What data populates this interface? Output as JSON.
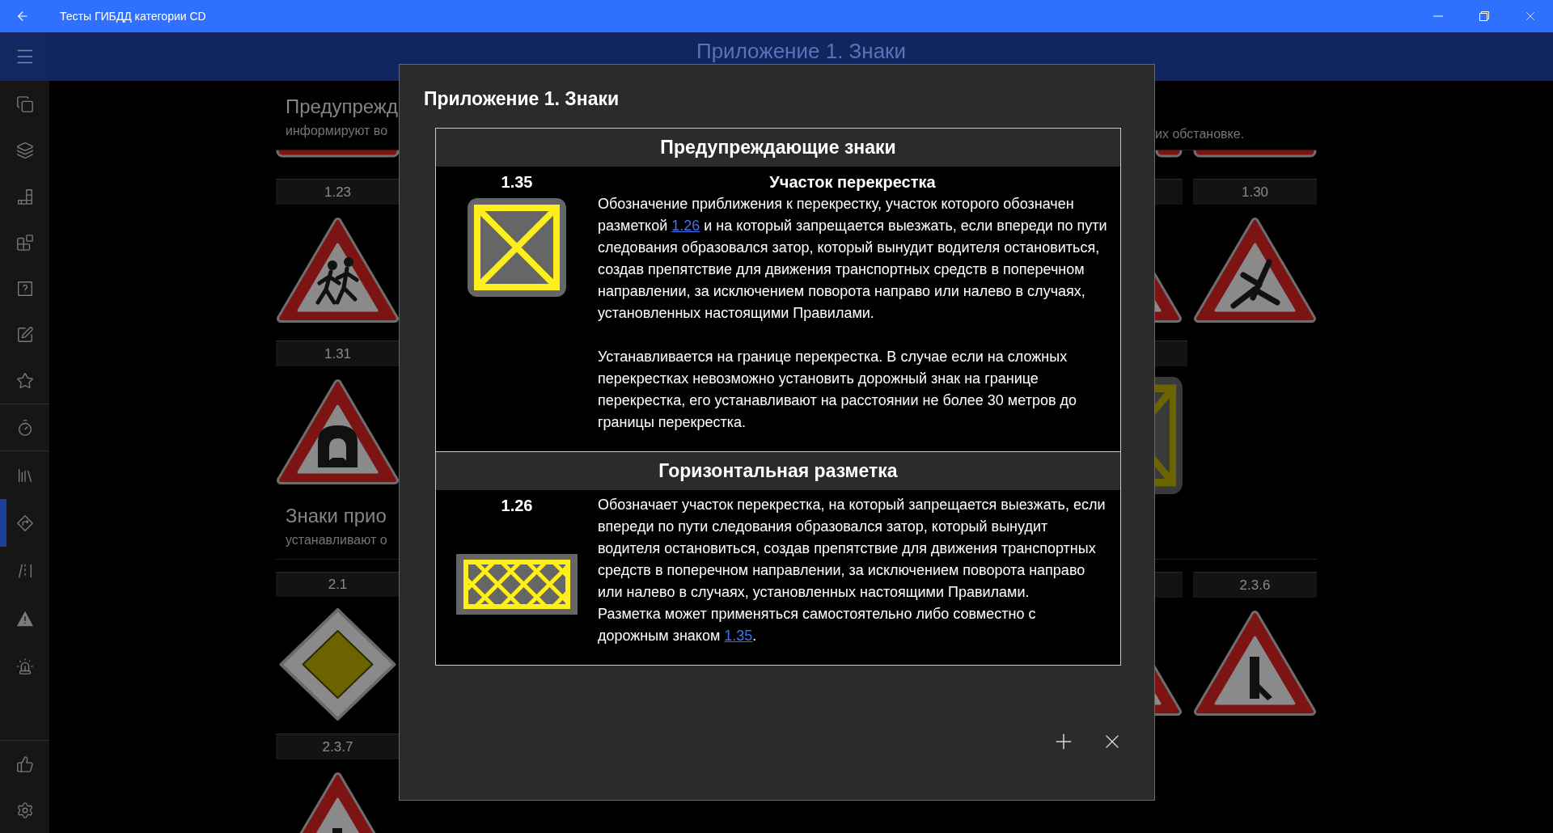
{
  "title_bar": {
    "title": "Тесты ГИБДД категории CD"
  },
  "sidebar": {
    "groups": [
      {
        "items": [
          {
            "selected": false
          },
          {
            "selected": false
          },
          {
            "selected": false
          },
          {
            "selected": false
          },
          {
            "selected": false
          },
          {
            "selected": false
          },
          {
            "selected": false
          }
        ]
      },
      {
        "items": [
          {
            "selected": false
          }
        ]
      },
      {
        "items": [
          {
            "selected": false
          },
          {
            "selected": true
          },
          {
            "selected": false
          },
          {
            "selected": false
          },
          {
            "selected": false
          }
        ]
      }
    ],
    "bottom_items": [
      {
        "selected": false
      },
      {
        "selected": false
      }
    ]
  },
  "header": {
    "title": "Приложение 1. Знаки"
  },
  "left_column": [
    {
      "kind": "heading",
      "title": "Предупрежд",
      "subtitle": "информируют во"
    },
    {
      "kind": "sign_edge"
    },
    {
      "kind": "card",
      "label": "1.23"
    },
    {
      "kind": "card",
      "label": "1.31"
    },
    {
      "kind": "heading",
      "title": "Знаки прио",
      "subtitle": "устанавливают о"
    },
    {
      "kind": "card",
      "label": "2.1"
    },
    {
      "kind": "card",
      "label": "2.3.7"
    }
  ],
  "right_column": {
    "text": "их обстановке.",
    "cards": [
      {
        "label": "1.30"
      },
      {
        "label": "2.3.6"
      }
    ]
  },
  "dialog": {
    "title": "Приложение 1. Знаки",
    "sections": [
      {
        "heading": "Предупреждающие знаки",
        "items": [
          {
            "number": "1.35",
            "kind": "sign",
            "title": "Участок перекрестка",
            "paragraphs": [
              [
                {
                  "kind": "text",
                  "text": "Обозначение приближения к перекрестку, участок которого обозначен разметкой "
                },
                {
                  "kind": "link",
                  "text": "1.26"
                },
                {
                  "kind": "text",
                  "text": " и на который запрещается выезжать, если впереди по пути следования образовался затор, который вынудит водителя остановиться, создав препятствие для движения транспортных средств в поперечном направлении, за исключением поворота направо или налево в случаях, установленных настоящими Правилами."
                }
              ],
              [
                {
                  "kind": "text",
                  "text": "Устанавливается на границе перекрестка. В случае если на сложных перекрестках невозможно установить дорожный знак на границе перекрестка, его устанавливают на расстоянии не более 30 метров до границы перекрестка."
                }
              ]
            ]
          }
        ]
      },
      {
        "heading": "Горизонтальная разметка",
        "items": [
          {
            "number": "1.26",
            "kind": "marking",
            "paragraphs": [
              [
                {
                  "kind": "text",
                  "text": "Обозначает участок перекрестка, на который запрещается выезжать, если впереди по пути следования образовался затор, который вынудит водителя остановиться, создав препятствие для движения транспортных средств в поперечном направлении, за исключением поворота направо или налево в случаях, установленных настоящими Правилами."
                },
                {
                  "kind": "break"
                },
                {
                  "kind": "text",
                  "text": "Разметка может применяться самостоятельно либо совместно с дорожным знаком "
                },
                {
                  "kind": "link",
                  "text": "1.35"
                },
                {
                  "kind": "text",
                  "text": "."
                }
              ]
            ]
          }
        ]
      }
    ]
  }
}
